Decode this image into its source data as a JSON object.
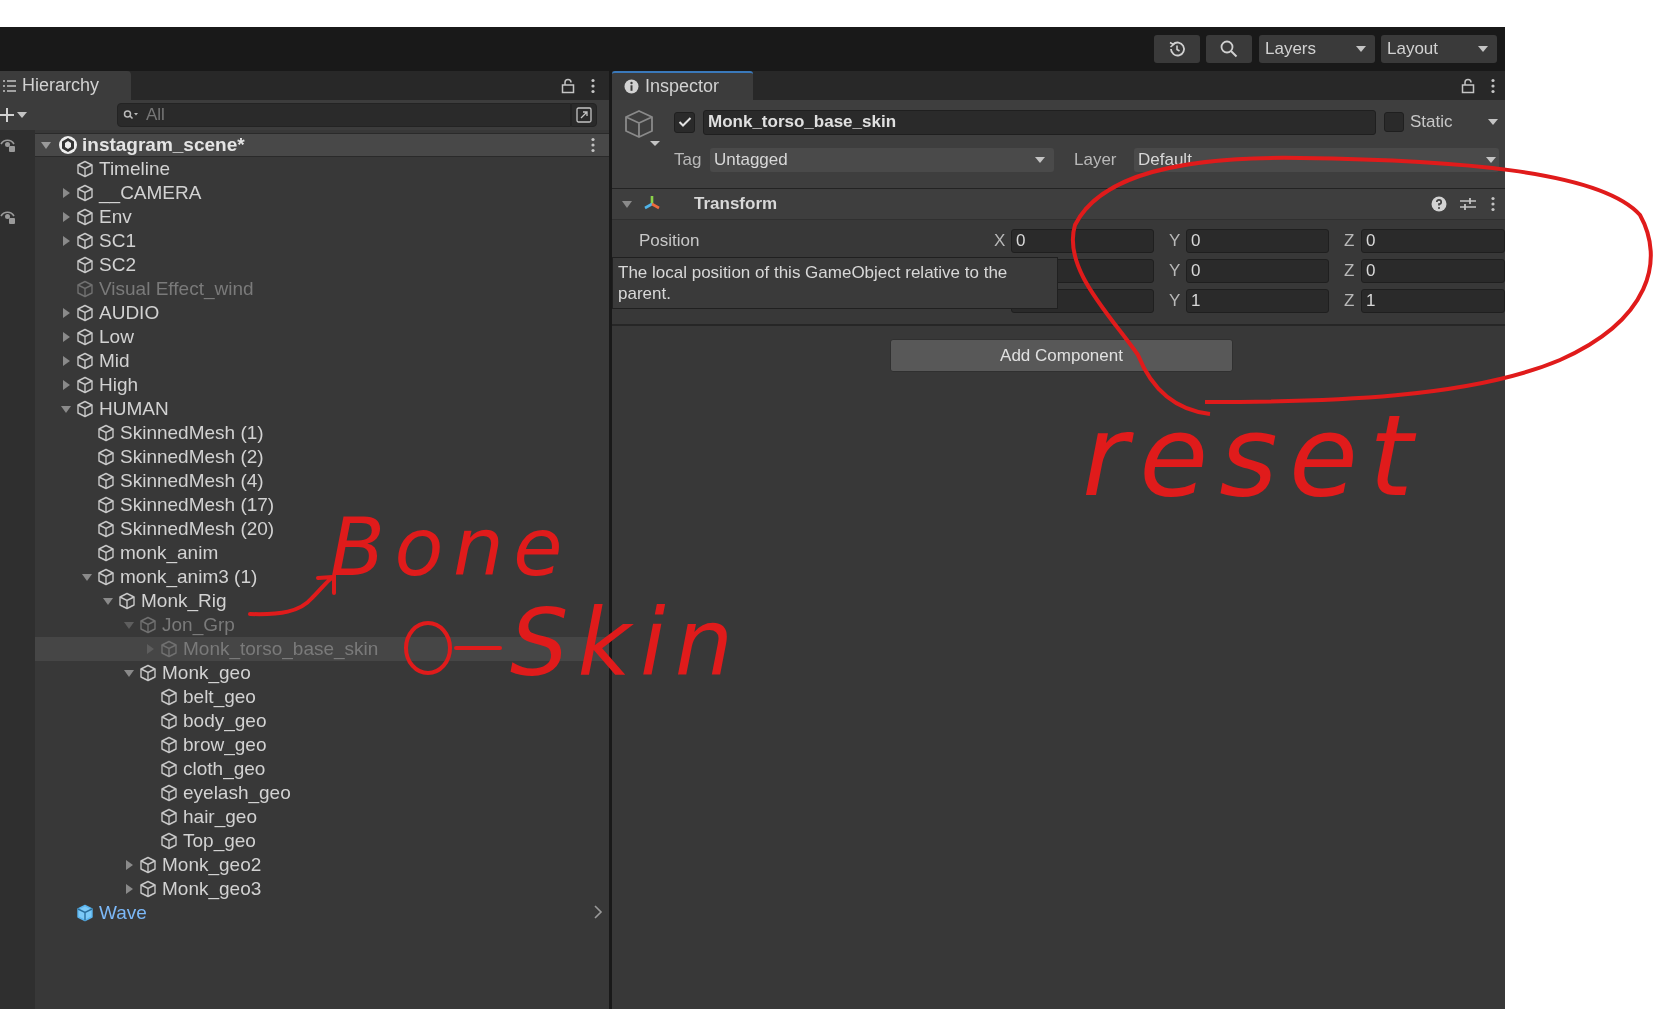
{
  "toolbar": {
    "dropdowns": [
      "Layers",
      "Layout"
    ]
  },
  "hierarchy": {
    "tab": "Hierarchy",
    "search": {
      "placeholder": "All"
    },
    "scene": {
      "name": "instagram_scene*",
      "expanded": true
    },
    "items": [
      {
        "name": "Timeline",
        "kind": "object",
        "disabled": false,
        "selected": false
      },
      {
        "name": "__CAMERA",
        "expanded": false,
        "kind": "object",
        "disabled": false,
        "selected": false
      },
      {
        "name": "Env",
        "expanded": false,
        "kind": "object",
        "disabled": false,
        "selected": false
      },
      {
        "name": "SC1",
        "expanded": false,
        "kind": "object",
        "disabled": false,
        "selected": false
      },
      {
        "name": "SC2",
        "kind": "object",
        "disabled": false,
        "selected": false
      },
      {
        "name": "Visual Effect_wind",
        "kind": "object",
        "disabled": true,
        "selected": false
      },
      {
        "name": "AUDIO",
        "expanded": false,
        "kind": "object",
        "disabled": false,
        "selected": false
      },
      {
        "name": "Low",
        "expanded": false,
        "kind": "object",
        "disabled": false,
        "selected": false
      },
      {
        "name": "Mid",
        "expanded": false,
        "kind": "object",
        "disabled": false,
        "selected": false
      },
      {
        "name": "High",
        "expanded": false,
        "kind": "object",
        "disabled": false,
        "selected": false
      },
      {
        "name": "HUMAN",
        "expanded": true,
        "kind": "object",
        "disabled": false,
        "selected": false,
        "children": [
          {
            "name": "SkinnedMesh (1)",
            "kind": "object",
            "disabled": false,
            "selected": false
          },
          {
            "name": "SkinnedMesh (2)",
            "kind": "object",
            "disabled": false,
            "selected": false
          },
          {
            "name": "SkinnedMesh (4)",
            "kind": "object",
            "disabled": false,
            "selected": false
          },
          {
            "name": "SkinnedMesh (17)",
            "kind": "object",
            "disabled": false,
            "selected": false
          },
          {
            "name": "SkinnedMesh (20)",
            "kind": "object",
            "disabled": false,
            "selected": false
          },
          {
            "name": "monk_anim",
            "kind": "object",
            "disabled": false,
            "selected": false
          },
          {
            "name": "monk_anim3 (1)",
            "expanded": true,
            "kind": "object",
            "disabled": false,
            "selected": false,
            "children": [
              {
                "name": "Monk_Rig",
                "expanded": true,
                "kind": "object",
                "disabled": false,
                "selected": false,
                "children": [
                  {
                    "name": "Jon_Grp",
                    "expanded": true,
                    "kind": "object",
                    "disabled": true,
                    "selected": false,
                    "children": [
                      {
                        "name": "Monk_torso_base_skin",
                        "expanded": false,
                        "kind": "object",
                        "disabled": true,
                        "selected": true
                      }
                    ]
                  },
                  {
                    "name": "Monk_geo",
                    "expanded": true,
                    "kind": "object",
                    "disabled": false,
                    "selected": false,
                    "children": [
                      {
                        "name": "belt_geo",
                        "kind": "object",
                        "disabled": false,
                        "selected": false
                      },
                      {
                        "name": "body_geo",
                        "kind": "object",
                        "disabled": false,
                        "selected": false
                      },
                      {
                        "name": "brow_geo",
                        "kind": "object",
                        "disabled": false,
                        "selected": false
                      },
                      {
                        "name": "cloth_geo",
                        "kind": "object",
                        "disabled": false,
                        "selected": false
                      },
                      {
                        "name": "eyelash_geo",
                        "kind": "object",
                        "disabled": false,
                        "selected": false
                      },
                      {
                        "name": "hair_geo",
                        "kind": "object",
                        "disabled": false,
                        "selected": false
                      },
                      {
                        "name": "Top_geo",
                        "kind": "object",
                        "disabled": false,
                        "selected": false
                      }
                    ]
                  },
                  {
                    "name": "Monk_geo2",
                    "expanded": false,
                    "kind": "object",
                    "disabled": false,
                    "selected": false
                  },
                  {
                    "name": "Monk_geo3",
                    "expanded": false,
                    "kind": "object",
                    "disabled": false,
                    "selected": false
                  }
                ]
              }
            ]
          }
        ]
      },
      {
        "name": "Wave",
        "kind": "prefab",
        "disabled": false,
        "selected": false
      }
    ]
  },
  "inspector": {
    "tab": "Inspector",
    "object": {
      "active": true,
      "name": "Monk_torso_base_skin",
      "static": false,
      "static_label": "Static",
      "tag_label": "Tag",
      "tag": "Untagged",
      "layer_label": "Layer",
      "layer": "Default"
    },
    "component": {
      "name": "Transform",
      "expanded": true,
      "rows": [
        {
          "label": "Position",
          "fields": [
            {
              "axis": "X",
              "value": "0"
            },
            {
              "axis": "Y",
              "value": "0"
            },
            {
              "axis": "Z",
              "value": "0"
            }
          ]
        },
        {
          "fields": [
            {
              "axis": "Y",
              "value": "0"
            },
            {
              "axis": "Z",
              "value": "0"
            }
          ]
        },
        {
          "fields": [
            {
              "axis": "Y",
              "value": "1"
            },
            {
              "axis": "Z",
              "value": "1"
            }
          ]
        }
      ],
      "tooltip": "The local position of this GameObject relative to the parent."
    },
    "add_component": "Add Component"
  },
  "annotations": [
    {
      "text": "Bone"
    },
    {
      "text": "Skin"
    },
    {
      "text": "reset"
    }
  ]
}
